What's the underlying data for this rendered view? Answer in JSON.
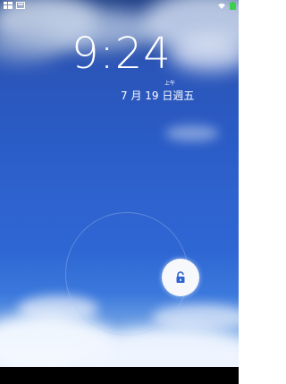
{
  "status_bar": {
    "left_icons": [
      "notification-app-icon",
      "image-notification-icon"
    ],
    "right_icons": [
      "wifi-icon",
      "battery-icon"
    ],
    "battery_color": "#3ccf4e"
  },
  "lockscreen": {
    "time": "9:24",
    "ampm": "上午",
    "date": "7 月 19 日週五",
    "unlock_icon": "unlock-icon",
    "accent_color": "#2f63cf"
  }
}
